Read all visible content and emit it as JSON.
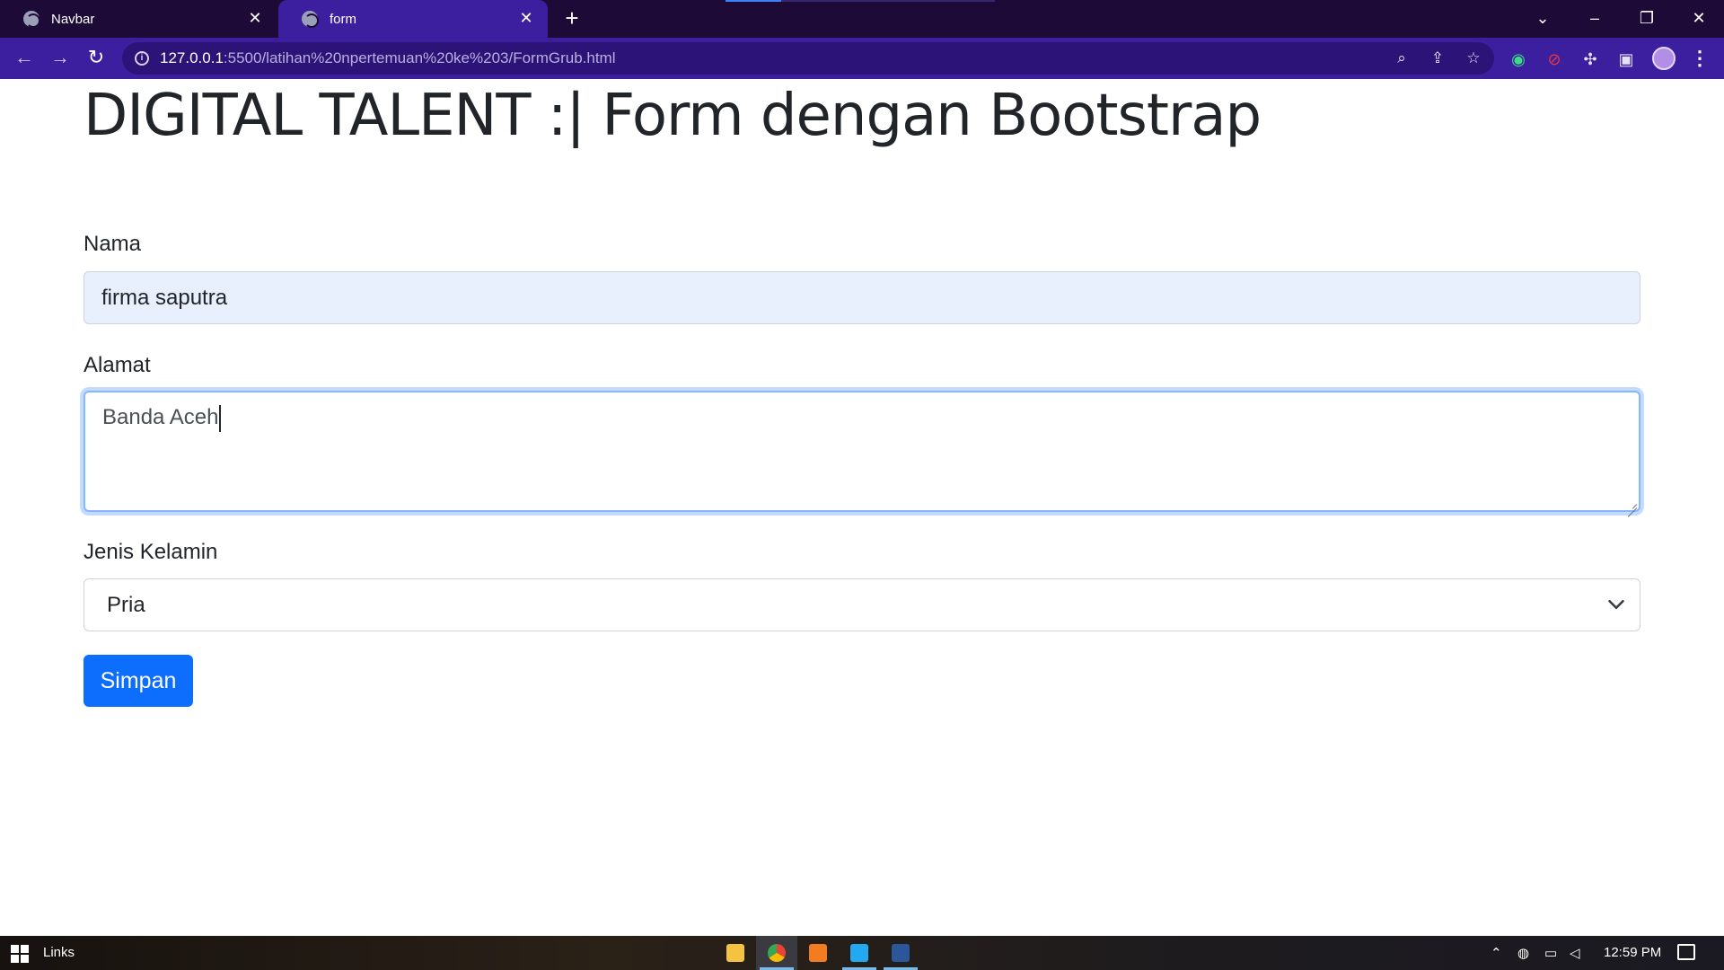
{
  "browser": {
    "tabs": [
      {
        "label": "Navbar",
        "active": false
      },
      {
        "label": "form",
        "active": true
      }
    ],
    "new_tab_label": "+",
    "address": {
      "host": "127.0.0.1",
      "path": ":5500/latihan%20npertemuan%20ke%203/FormGrub.html"
    },
    "window_controls": {
      "minimize": "–",
      "restore": "❐",
      "close": "✕",
      "tab_search": "⌄"
    }
  },
  "page": {
    "title": "DIGITAL TALENT :| Form dengan Bootstrap",
    "fields": {
      "nama": {
        "label": "Nama",
        "value": "firma saputra"
      },
      "alamat": {
        "label": "Alamat",
        "value": "Banda Aceh"
      },
      "jenis_kelamin": {
        "label": "Jenis Kelamin",
        "selected": "Pria"
      }
    },
    "submit_label": "Simpan"
  },
  "taskbar": {
    "search_text": "Links",
    "apps": [
      "file-explorer",
      "chrome",
      "xampp",
      "vscode",
      "word"
    ],
    "clock": "12:59 PM"
  },
  "colors": {
    "titlebar": "#1e0a36",
    "toolbar": "#3c1f9f",
    "primary_button": "#0d6efd",
    "autofill_bg": "#e8f0fe",
    "focus_border": "#86b7fe"
  }
}
